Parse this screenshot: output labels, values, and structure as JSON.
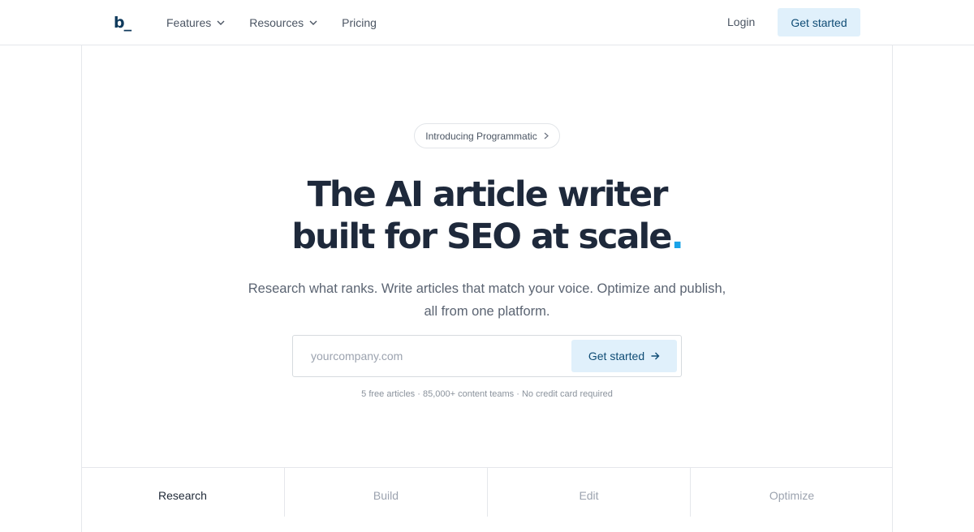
{
  "header": {
    "logo": "b_",
    "nav": [
      {
        "label": "Features",
        "has_dropdown": true
      },
      {
        "label": "Resources",
        "has_dropdown": true
      },
      {
        "label": "Pricing",
        "has_dropdown": false
      }
    ],
    "login_label": "Login",
    "cta_label": "Get started"
  },
  "announcement": {
    "label": "Introducing Programmatic",
    "icon": "chevron-right-icon"
  },
  "hero": {
    "title_line1": "The AI article writer",
    "title_line2": "built for SEO at scale",
    "title_dot": ".",
    "accent_color": "#1aa3e8",
    "subtitle": "Research what ranks. Write articles that match your voice. Optimize and publish, all from one platform."
  },
  "signup": {
    "placeholder": "yourcompany.com",
    "value": "",
    "button_label": "Get started",
    "button_icon": "arrow-right-icon"
  },
  "fineprint": "5 free articles · 85,000+ content teams · No credit card required",
  "tabs": [
    {
      "label": "Research",
      "active": true
    },
    {
      "label": "Build",
      "active": false
    },
    {
      "label": "Edit",
      "active": false
    },
    {
      "label": "Optimize",
      "active": false
    }
  ]
}
